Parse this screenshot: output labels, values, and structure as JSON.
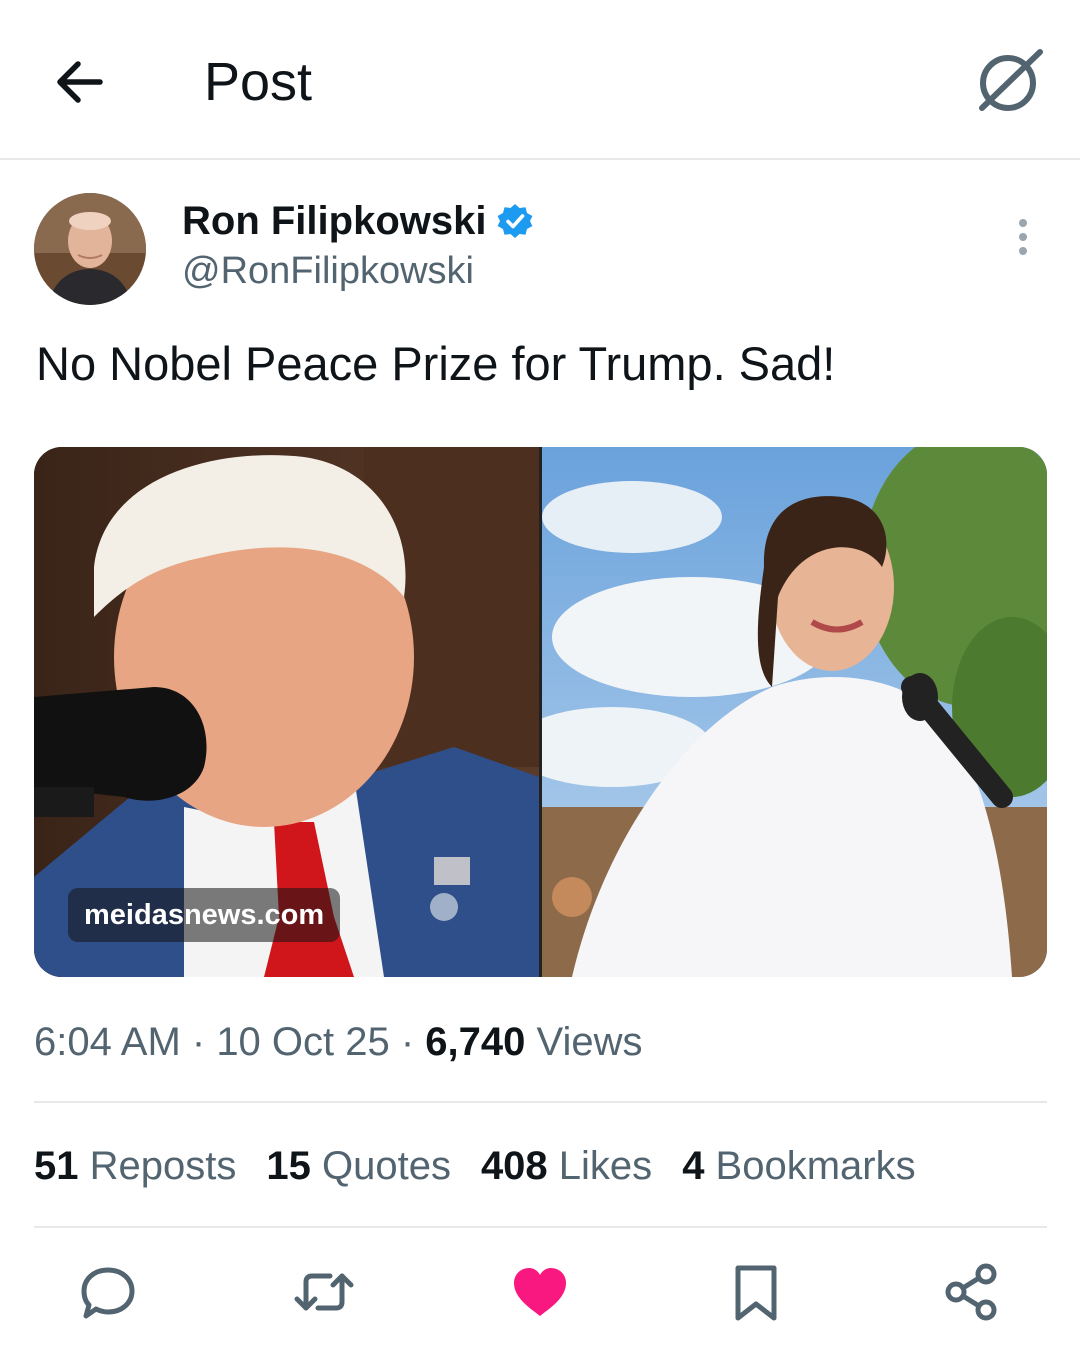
{
  "header": {
    "title": "Post",
    "back_icon": "arrow-left-icon",
    "grok_icon": "grok-icon"
  },
  "author": {
    "name": "Ron Filipkowski",
    "handle": "@RonFilipkowski",
    "verified": true,
    "verified_color": "#1d9bf0"
  },
  "tweet": {
    "text": "No Nobel Peace Prize for Trump. Sad!"
  },
  "media": {
    "watermark": "meidasnews.com"
  },
  "meta": {
    "time": "6:04 AM",
    "sep1": " · ",
    "date": "10 Oct 25",
    "sep2": " · ",
    "views_count": "6,740",
    "views_label": " Views"
  },
  "stats": {
    "reposts": {
      "count": "51",
      "label": " Reposts"
    },
    "quotes": {
      "count": "15",
      "label": " Quotes"
    },
    "likes": {
      "count": "408",
      "label": " Likes"
    },
    "bookmarks": {
      "count": "4",
      "label": " Bookmarks"
    }
  },
  "actions": {
    "reply_icon": "reply-icon",
    "repost_icon": "repost-icon",
    "like_icon": "heart-icon",
    "like_active": true,
    "like_color": "#f91880",
    "bookmark_icon": "bookmark-icon",
    "share_icon": "share-icon"
  },
  "colors": {
    "text": "#0f1419",
    "secondary": "#536471",
    "border": "#e6e8ea"
  }
}
